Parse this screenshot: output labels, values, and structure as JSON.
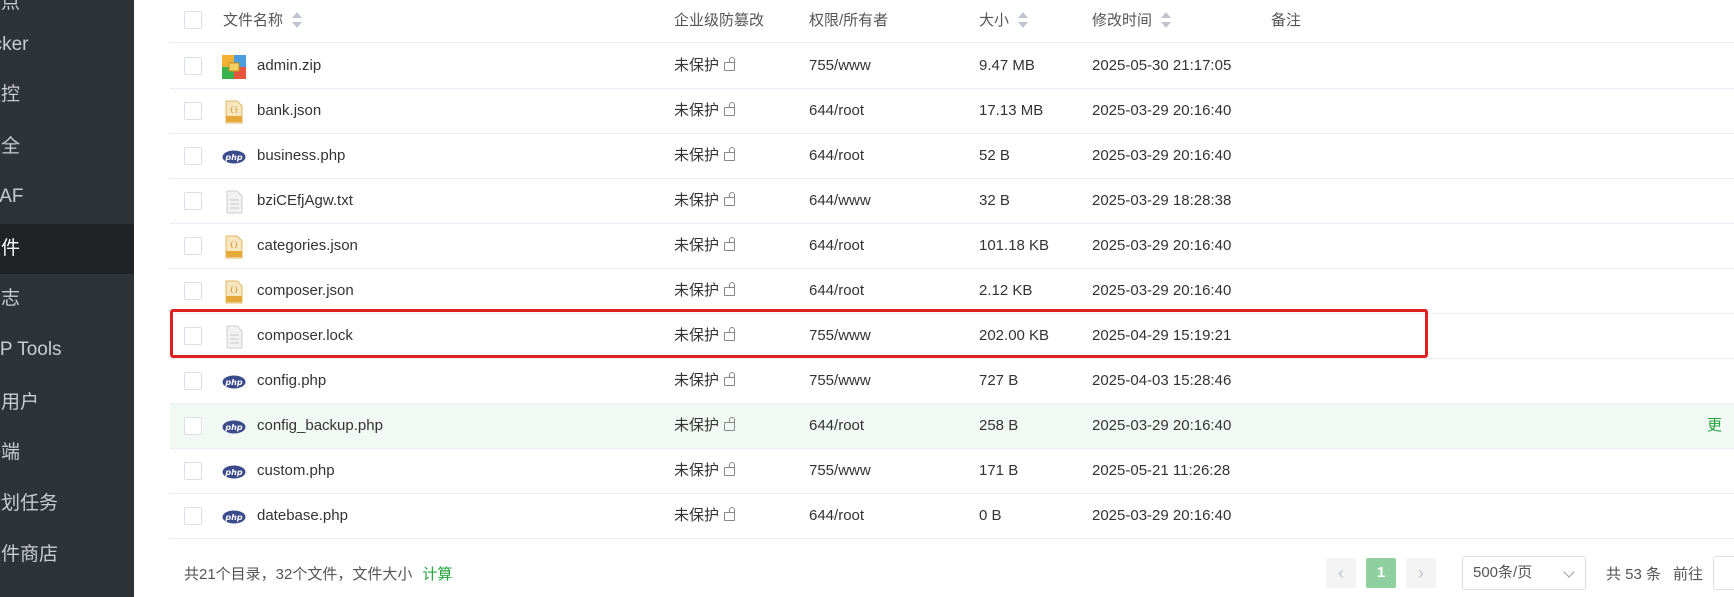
{
  "sidebar": {
    "items": [
      {
        "label": "站点"
      },
      {
        "label": "ocker"
      },
      {
        "label": "监控"
      },
      {
        "label": "安全"
      },
      {
        "label": "WAF"
      },
      {
        "label": "文件"
      },
      {
        "label": "日志"
      },
      {
        "label": "WP Tools"
      },
      {
        "label": "多用户"
      },
      {
        "label": "终端"
      },
      {
        "label": "计划任务"
      },
      {
        "label": "软件商店"
      }
    ],
    "active_index": 5
  },
  "table": {
    "columns": {
      "name": "文件名称",
      "protect": "企业级防篡改",
      "perm": "权限/所有者",
      "size": "大小",
      "mtime": "修改时间",
      "note": "备注"
    },
    "rows": [
      {
        "name": "admin.zip",
        "icon": "zip-archive-icon",
        "protect": "未保护",
        "perm": "755/www",
        "size": "9.47 MB",
        "mtime": "2025-05-30 21:17:05"
      },
      {
        "name": "bank.json",
        "icon": "json-file-icon",
        "protect": "未保护",
        "perm": "644/root",
        "size": "17.13 MB",
        "mtime": "2025-03-29 20:16:40"
      },
      {
        "name": "business.php",
        "icon": "php-file-icon",
        "protect": "未保护",
        "perm": "644/root",
        "size": "52 B",
        "mtime": "2025-03-29 20:16:40"
      },
      {
        "name": "bziCEfjAgw.txt",
        "icon": "text-file-icon",
        "protect": "未保护",
        "perm": "644/www",
        "size": "32 B",
        "mtime": "2025-03-29 18:28:38"
      },
      {
        "name": "categories.json",
        "icon": "json-file-icon",
        "protect": "未保护",
        "perm": "644/root",
        "size": "101.18 KB",
        "mtime": "2025-03-29 20:16:40"
      },
      {
        "name": "composer.json",
        "icon": "json-file-icon",
        "protect": "未保护",
        "perm": "644/root",
        "size": "2.12 KB",
        "mtime": "2025-03-29 20:16:40"
      },
      {
        "name": "composer.lock",
        "icon": "text-file-icon",
        "protect": "未保护",
        "perm": "755/www",
        "size": "202.00 KB",
        "mtime": "2025-04-29 15:19:21"
      },
      {
        "name": "config.php",
        "icon": "php-file-icon",
        "protect": "未保护",
        "perm": "755/www",
        "size": "727 B",
        "mtime": "2025-04-03 15:28:46"
      },
      {
        "name": "config_backup.php",
        "icon": "php-file-icon",
        "protect": "未保护",
        "perm": "644/root",
        "size": "258 B",
        "mtime": "2025-03-29 20:16:40",
        "action": "更"
      },
      {
        "name": "custom.php",
        "icon": "php-file-icon",
        "protect": "未保护",
        "perm": "755/www",
        "size": "171 B",
        "mtime": "2025-05-21 11:26:28"
      },
      {
        "name": "datebase.php",
        "icon": "php-file-icon",
        "protect": "未保护",
        "perm": "644/root",
        "size": "0 B",
        "mtime": "2025-03-29 20:16:40"
      }
    ]
  },
  "footer": {
    "summary": "共21个目录，32个文件，文件大小",
    "calc_label": "计算",
    "prev": "‹",
    "next": "›",
    "current_page": "1",
    "page_size": "500条/页",
    "total": "共 53 条",
    "goto": "前往"
  },
  "colors": {
    "accent": "#20a53a",
    "highlight": "#e02020",
    "sidebar_bg": "#2e3338"
  }
}
